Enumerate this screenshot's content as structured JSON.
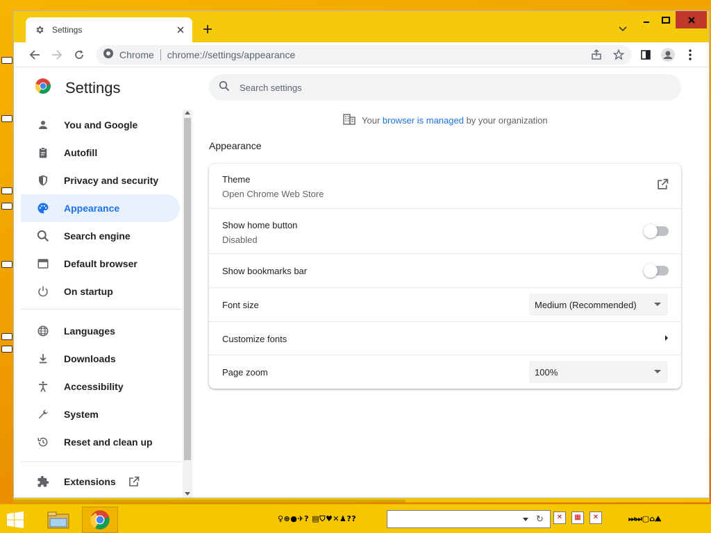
{
  "browser": {
    "tab_title": "Settings",
    "omnibox_site": "Chrome",
    "omnibox_url": "chrome://settings/appearance"
  },
  "settings": {
    "page_title": "Settings",
    "search_placeholder": "Search settings",
    "managed_notice": {
      "prefix": "Your ",
      "link": "browser is managed",
      "suffix": " by your organization"
    },
    "nav": [
      {
        "label": "You and Google",
        "icon": "person-icon"
      },
      {
        "label": "Autofill",
        "icon": "clipboard-icon"
      },
      {
        "label": "Privacy and security",
        "icon": "shield-icon"
      },
      {
        "label": "Appearance",
        "icon": "palette-icon",
        "active": true
      },
      {
        "label": "Search engine",
        "icon": "search-icon"
      },
      {
        "label": "Default browser",
        "icon": "browser-icon"
      },
      {
        "label": "On startup",
        "icon": "power-icon"
      },
      {
        "label": "Languages",
        "icon": "globe-icon"
      },
      {
        "label": "Downloads",
        "icon": "download-icon"
      },
      {
        "label": "Accessibility",
        "icon": "accessibility-icon"
      },
      {
        "label": "System",
        "icon": "wrench-icon"
      },
      {
        "label": "Reset and clean up",
        "icon": "history-icon"
      },
      {
        "label": "Extensions",
        "icon": "puzzle-icon"
      }
    ],
    "section_title": "Appearance",
    "rows": {
      "theme": {
        "label": "Theme",
        "sub": "Open Chrome Web Store"
      },
      "home_button": {
        "label": "Show home button",
        "sub": "Disabled",
        "enabled": false
      },
      "bookmarks_bar": {
        "label": "Show bookmarks bar",
        "enabled": false
      },
      "font_size": {
        "label": "Font size",
        "value": "Medium (Recommended)"
      },
      "customize_fonts": {
        "label": "Customize fonts"
      },
      "page_zoom": {
        "label": "Page zoom",
        "value": "100%"
      }
    }
  },
  "taskbar": {
    "glyphs_left": "♀⊕●✈?  ▤⛉♥✕♟??",
    "glyphs_right": "⏭⏭▢⌂⛰"
  },
  "colors": {
    "accent": "#1a73e8",
    "active_nav_bg": "#e8f0fe",
    "titlebar": "#f5ca0b",
    "close_button": "#c0392b"
  }
}
